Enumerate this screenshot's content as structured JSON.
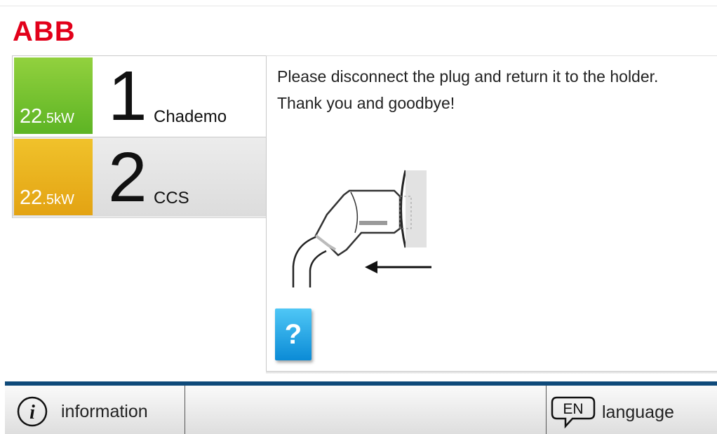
{
  "brand": {
    "logo_text": "ABB",
    "color": "#e2001a"
  },
  "connectors": [
    {
      "power_value": "22",
      "power_decimal": ".5",
      "power_unit": "kW",
      "number": "1",
      "name": "Chademo",
      "color": "#5db424"
    },
    {
      "power_value": "22",
      "power_decimal": ".5",
      "power_unit": "kW",
      "number": "2",
      "name": "CCS",
      "color": "#e3a313"
    }
  ],
  "main": {
    "message_line1": "Please disconnect the plug and return it to the holder.",
    "message_line2": "Thank you and goodbye!",
    "help_label": "?",
    "illustration_icon": "plug-return-illustration"
  },
  "footer": {
    "info_icon_glyph": "i",
    "info_label": "information",
    "language_code": "EN",
    "language_label": "language",
    "accent_color": "#0f4a7a"
  }
}
